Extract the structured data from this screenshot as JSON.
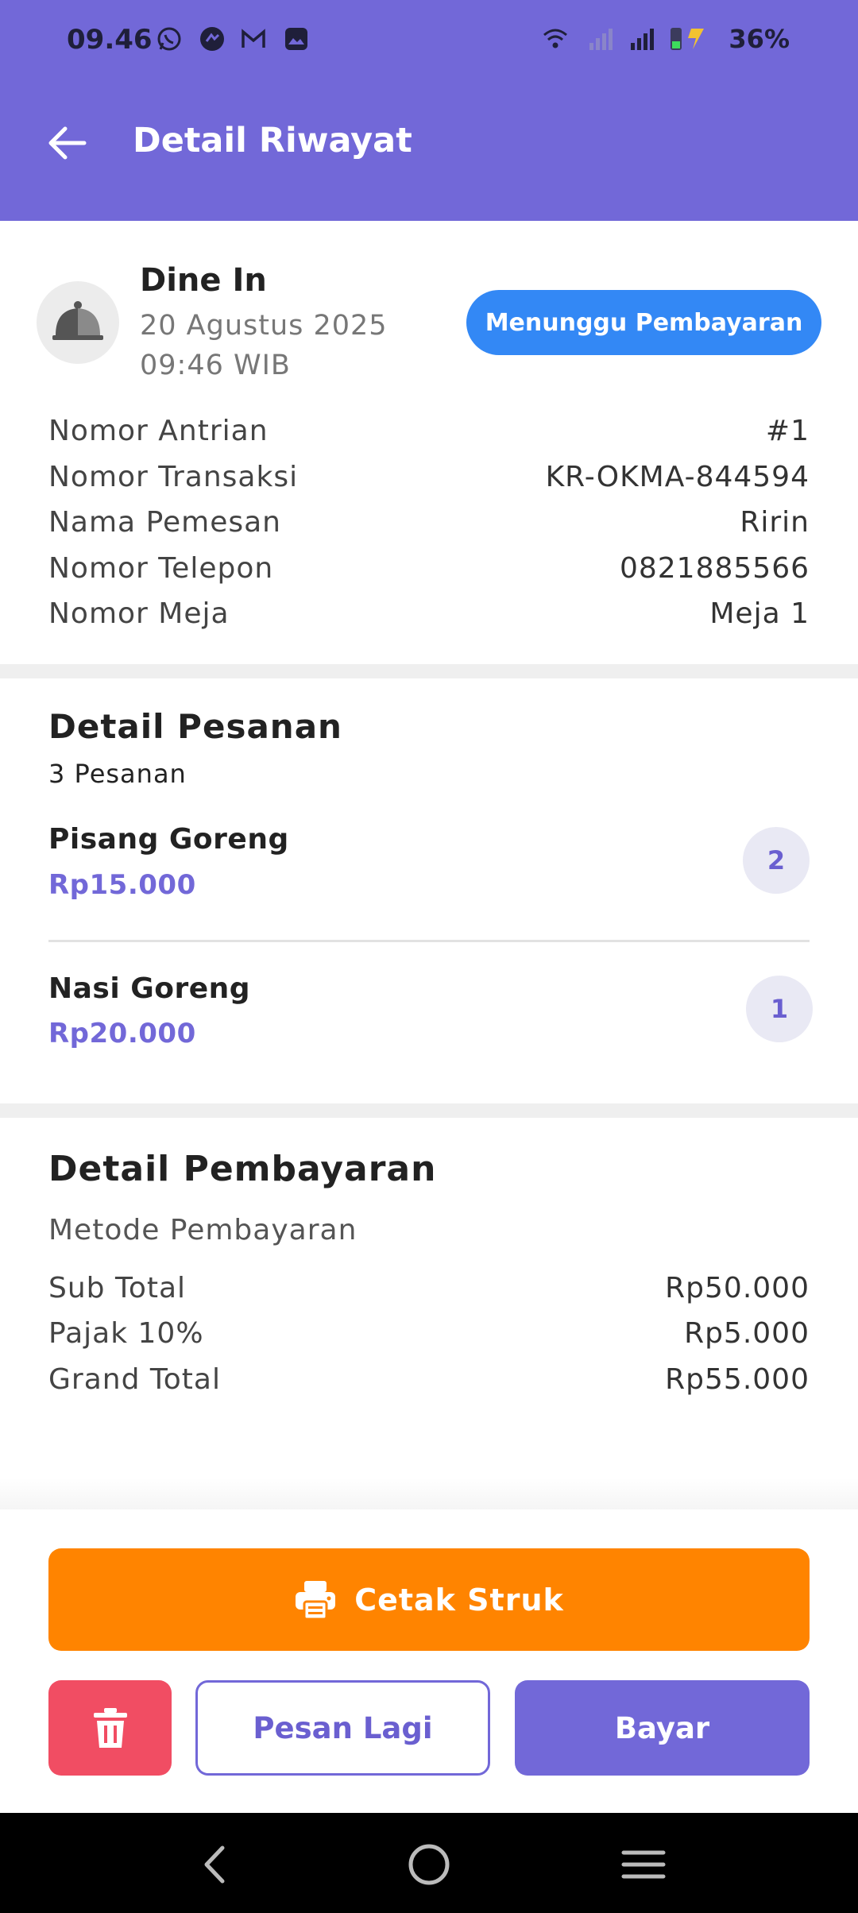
{
  "status_bar": {
    "time": "09.46",
    "battery": "36%",
    "icons": [
      "whatsapp-icon",
      "messenger-icon",
      "gmail-icon",
      "gallery-icon",
      "wifi-icon",
      "signal-icon",
      "signal-icon",
      "battery-charging-icon"
    ]
  },
  "appbar": {
    "title": "Detail Riwayat",
    "back_icon": "arrow-left-icon"
  },
  "order": {
    "type": "Dine In",
    "date": "20 Agustus 2025",
    "time": "09:46 WIB",
    "status": "Menunggu Pembayaran",
    "status_color": "#3388f5",
    "icon": "cloche-icon"
  },
  "info": [
    {
      "label": "Nomor Antrian",
      "value": "#1"
    },
    {
      "label": "Nomor Transaksi",
      "value": "KR-OKMA-844594"
    },
    {
      "label": "Nama Pemesan",
      "value": "Ririn"
    },
    {
      "label": "Nomor Telepon",
      "value": "0821885566"
    },
    {
      "label": "Nomor Meja",
      "value": "Meja 1"
    }
  ],
  "order_detail": {
    "title": "Detail Pesanan",
    "count": "3 Pesanan",
    "items": [
      {
        "name": "Pisang Goreng",
        "price": "Rp15.000",
        "qty": "2"
      },
      {
        "name": "Nasi Goreng",
        "price": "Rp20.000",
        "qty": "1"
      }
    ]
  },
  "payment": {
    "title": "Detail Pembayaran",
    "method_label": "Metode Pembayaran",
    "rows": [
      {
        "label": "Sub Total",
        "value": "Rp50.000"
      },
      {
        "label": "Pajak 10%",
        "value": "Rp5.000"
      },
      {
        "label": "Grand Total",
        "value": "Rp55.000"
      }
    ]
  },
  "actions": {
    "print": "Cetak Struk",
    "reorder": "Pesan Lagi",
    "pay": "Bayar",
    "print_color": "#ff8400",
    "delete_color": "#f14d63",
    "accent": "#7268d8"
  },
  "nav": {
    "back": "nav-back-icon",
    "home": "nav-home-icon",
    "menu": "nav-menu-icon"
  }
}
